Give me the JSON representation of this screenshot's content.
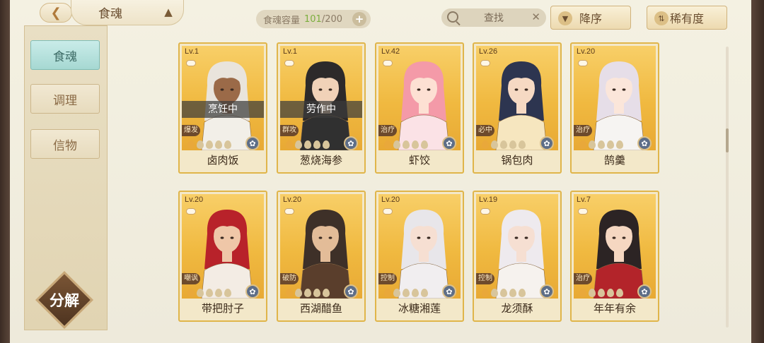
{
  "header": {
    "title": "食魂",
    "capacity_label": "食魂容量",
    "capacity_used": "101",
    "capacity_total": "/200",
    "search_label": "查找",
    "sort_order_label": "降序",
    "sort_key_label": "稀有度"
  },
  "sidebar": {
    "items": [
      {
        "label": "食魂",
        "active": true
      },
      {
        "label": "调理",
        "active": false
      },
      {
        "label": "信物",
        "active": false
      }
    ],
    "decompose_label": "分解"
  },
  "cards": [
    {
      "level": "Lv.1",
      "status": "烹饪中",
      "tag": "爆发",
      "name": "卤肉饭",
      "stars": 1,
      "hair": "#e9e4dc",
      "outfit": "#f2efe8",
      "skin": "#9b6a48"
    },
    {
      "level": "Lv.1",
      "status": "劳作中",
      "tag": "群攻",
      "name": "葱烧海参",
      "stars": 1,
      "hair": "#2d2a2a",
      "outfit": "#303030",
      "skin": "#f1d2b8"
    },
    {
      "level": "Lv.42",
      "status": "",
      "tag": "治疗",
      "name": "虾饺",
      "stars": 1,
      "hair": "#f49aa8",
      "outfit": "#fbe2e6",
      "skin": "#fde0d3"
    },
    {
      "level": "Lv.26",
      "status": "",
      "tag": "必中",
      "name": "锅包肉",
      "stars": 1,
      "hair": "#2d3550",
      "outfit": "#f6e6bf",
      "skin": "#f6d9c3"
    },
    {
      "level": "Lv.20",
      "status": "",
      "tag": "治疗",
      "name": "鹄羹",
      "stars": 1,
      "hair": "#e6dee8",
      "outfit": "#f6f4f2",
      "skin": "#fbe6da"
    },
    {
      "level": "Lv.20",
      "status": "",
      "tag": "嘲讽",
      "name": "带把肘子",
      "stars": 1,
      "hair": "#b8222a",
      "outfit": "#f3ece4",
      "skin": "#efc7a8"
    },
    {
      "level": "Lv.20",
      "status": "",
      "tag": "破防",
      "name": "西湖醋鱼",
      "stars": 1,
      "hair": "#3e3028",
      "outfit": "#5a3e2c",
      "skin": "#e3bc98"
    },
    {
      "level": "Lv.20",
      "status": "",
      "tag": "控制",
      "name": "冰糖湘莲",
      "stars": 1,
      "hair": "#e8e6ea",
      "outfit": "#f1eef0",
      "skin": "#f6dfd2"
    },
    {
      "level": "Lv.19",
      "status": "",
      "tag": "控制",
      "name": "龙须酥",
      "stars": 1,
      "hair": "#eeeaee",
      "outfit": "#f6f2ee",
      "skin": "#f6dfd2"
    },
    {
      "level": "Lv.7",
      "status": "",
      "tag": "治疗",
      "name": "年年有余",
      "stars": 1,
      "hair": "#2c2424",
      "outfit": "#b3242a",
      "skin": "#f5d7c1"
    }
  ],
  "colors": {
    "accent_gold": "#e0b54a",
    "active_tab": "#a6d8d2",
    "capacity_used": "#7cae3e"
  }
}
